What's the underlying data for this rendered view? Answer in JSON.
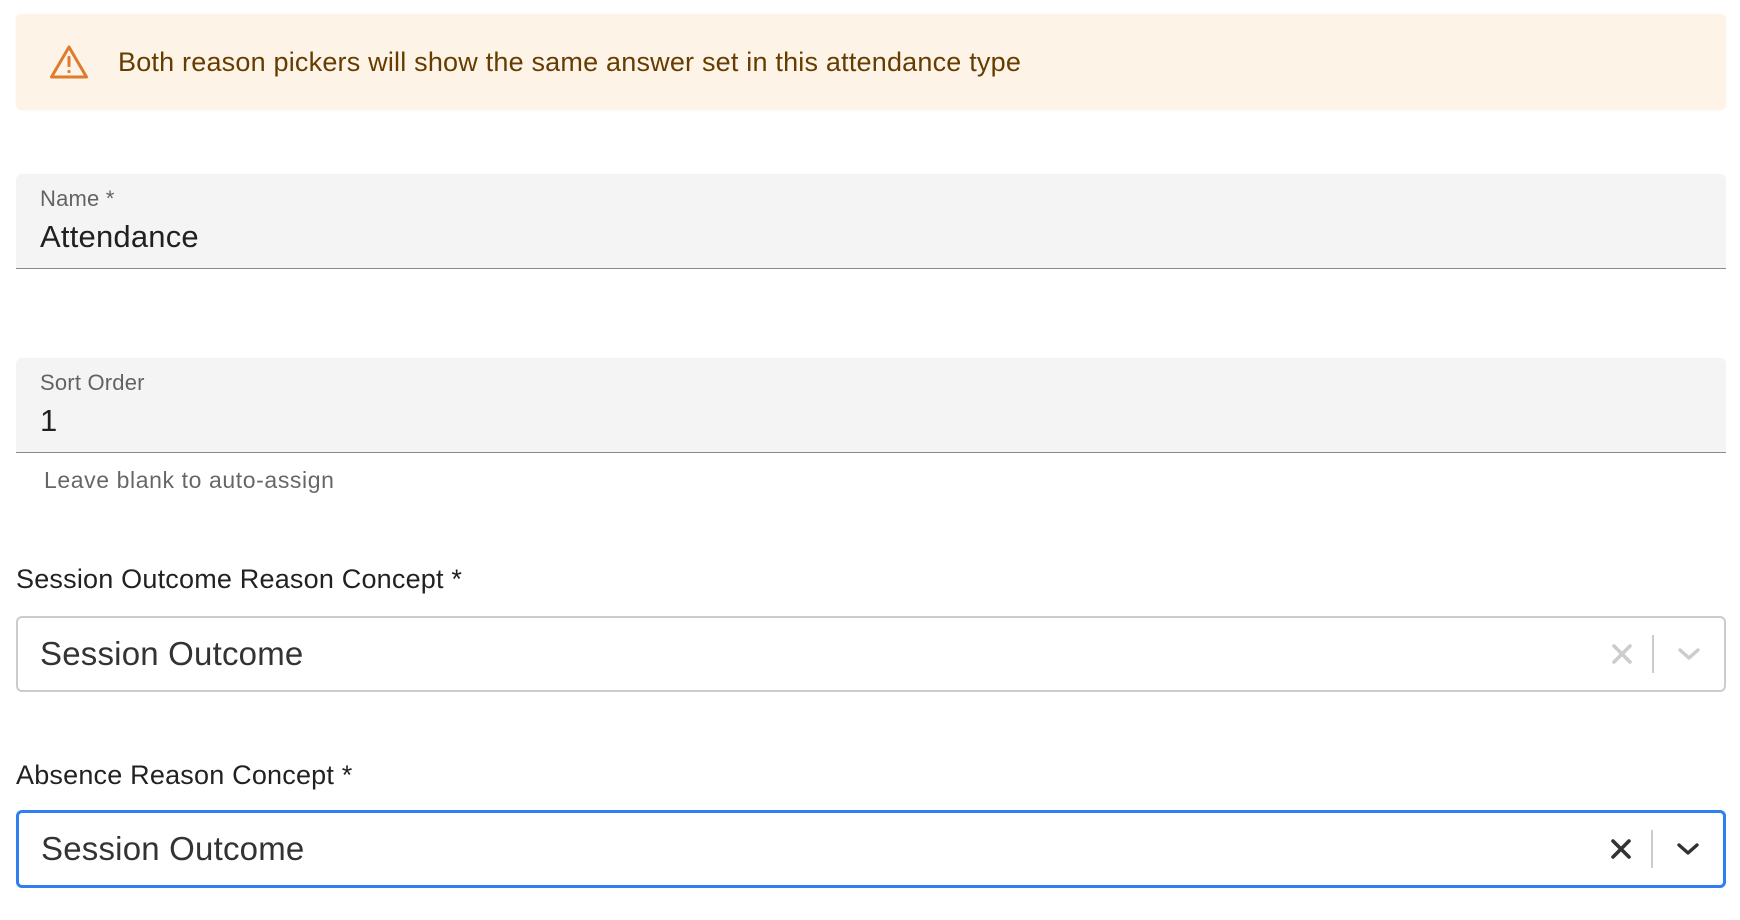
{
  "alert": {
    "icon": "warning-icon",
    "message": "Both reason pickers will show the same answer set in this attendance type",
    "icon_color": "#e07a2e",
    "text_color": "#663c00",
    "background": "#fdf4e7"
  },
  "name_field": {
    "label": "Name *",
    "value": "Attendance"
  },
  "sort_order_field": {
    "label": "Sort Order",
    "value": "1",
    "helper_text": "Leave blank to auto-assign"
  },
  "session_outcome_select": {
    "label": "Session Outcome Reason Concept *",
    "value": "Session Outcome",
    "clear_icon": "close-icon",
    "dropdown_icon": "chevron-down-icon"
  },
  "absence_reason_select": {
    "label": "Absence Reason Concept *",
    "value": "Session Outcome",
    "clear_icon": "close-icon",
    "dropdown_icon": "chevron-down-icon",
    "focus_color": "#2f7ff0"
  }
}
